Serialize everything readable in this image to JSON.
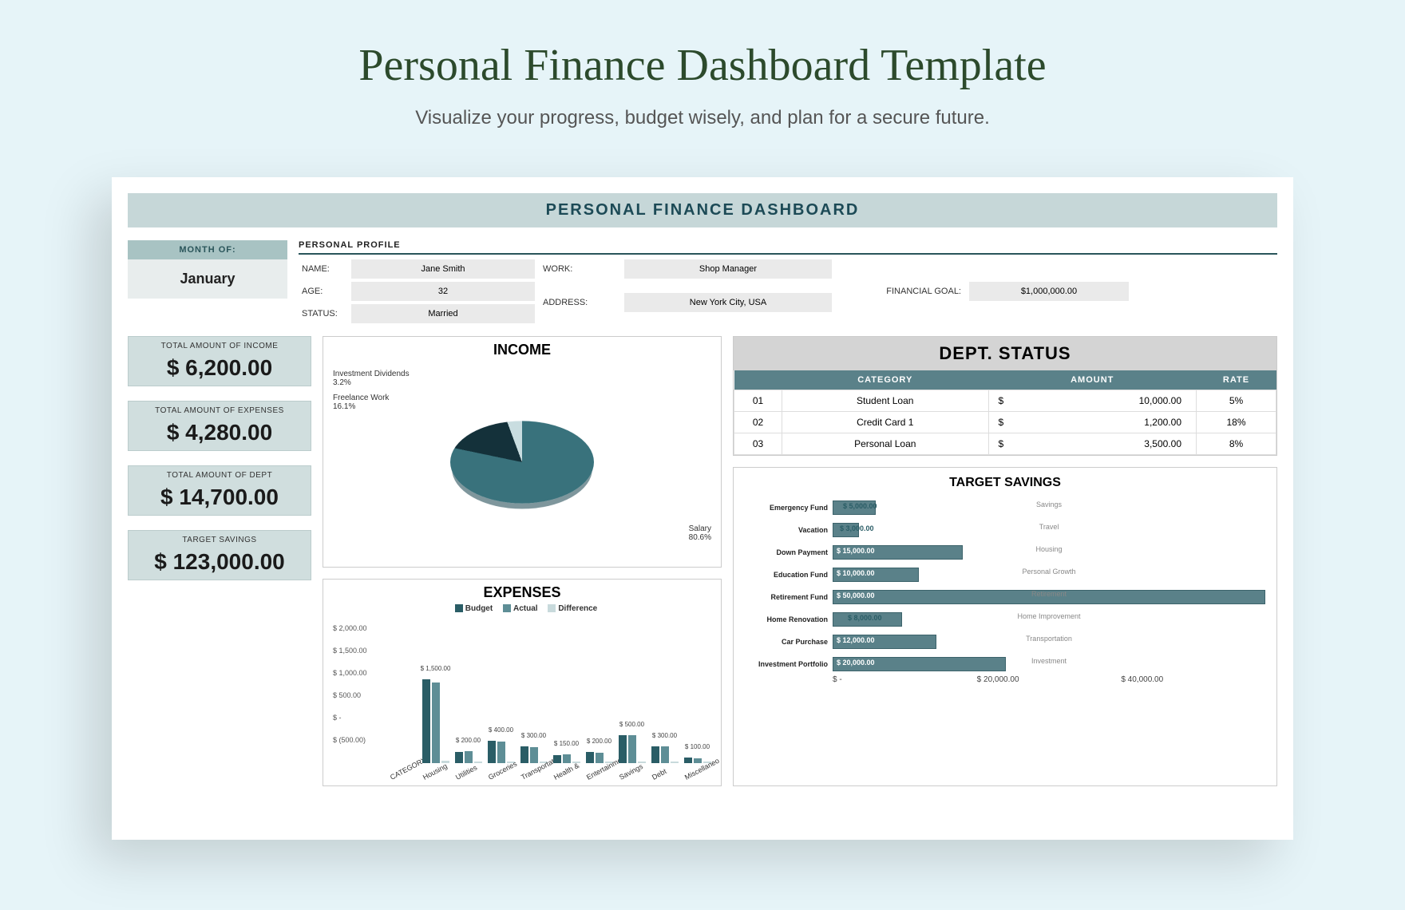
{
  "title": "Personal Finance Dashboard Template",
  "subtitle": "Visualize your progress, budget wisely, and plan for a secure future.",
  "header": "PERSONAL FINANCE DASHBOARD",
  "month": {
    "label": "MONTH OF:",
    "value": "January"
  },
  "profile": {
    "title": "PERSONAL PROFILE",
    "name_label": "NAME:",
    "name": "Jane Smith",
    "age_label": "AGE:",
    "age": "32",
    "status_label": "STATUS:",
    "status": "Married",
    "work_label": "WORK:",
    "work": "Shop Manager",
    "address_label": "ADDRESS:",
    "address": "New York City, USA",
    "goal_label": "FINANCIAL GOAL:",
    "goal": "$1,000,000.00"
  },
  "stats": {
    "income_label": "TOTAL AMOUNT OF INCOME",
    "income": "$  6,200.00",
    "expenses_label": "TOTAL AMOUNT OF EXPENSES",
    "expenses": "$  4,280.00",
    "dept_label": "TOTAL AMOUNT OF DEPT",
    "dept": "$  14,700.00",
    "savings_label": "TARGET SAVINGS",
    "savings": "$ 123,000.00"
  },
  "income_panel": {
    "title": "INCOME",
    "labels": {
      "dividends": "Investment Dividends",
      "dividends_pct": "3.2%",
      "freelance": "Freelance Work",
      "freelance_pct": "16.1%",
      "salary": "Salary",
      "salary_pct": "80.6%"
    }
  },
  "expenses_panel": {
    "title": "EXPENSES",
    "legend": {
      "budget": "Budget",
      "actual": "Actual",
      "diff": "Difference"
    },
    "yaxis": [
      "$ 2,000.00",
      "$ 1,500.00",
      "$ 1,000.00",
      "$ 500.00",
      "$ -",
      "$ (500.00)"
    ]
  },
  "dept_panel": {
    "title": "DEPT. STATUS",
    "headers": {
      "cat": "CATEGORY",
      "amount": "AMOUNT",
      "rate": "RATE"
    },
    "rows": [
      {
        "n": "01",
        "cat": "Student Loan",
        "amt": "10,000.00",
        "rate": "5%"
      },
      {
        "n": "02",
        "cat": "Credit Card 1",
        "amt": "1,200.00",
        "rate": "18%"
      },
      {
        "n": "03",
        "cat": "Personal Loan",
        "amt": "3,500.00",
        "rate": "8%"
      }
    ]
  },
  "savings_panel": {
    "title": "TARGET SAVINGS",
    "axis": [
      "$ -",
      "$ 20,000.00",
      "$ 40,000.00"
    ]
  },
  "chart_data": [
    {
      "type": "pie",
      "title": "INCOME",
      "series": [
        {
          "name": "Salary",
          "value": 80.6
        },
        {
          "name": "Freelance Work",
          "value": 16.1
        },
        {
          "name": "Investment Dividends",
          "value": 3.2
        }
      ]
    },
    {
      "type": "bar",
      "title": "EXPENSES",
      "categories": [
        "CATEGORY",
        "Housing",
        "Utilities",
        "Groceries",
        "Transportati",
        "Health &",
        "Entertainme",
        "Savings",
        "Debt",
        "Miscellaneo"
      ],
      "series": [
        {
          "name": "Budget",
          "values": [
            null,
            1500,
            200,
            400,
            300,
            150,
            200,
            500,
            300,
            100
          ]
        },
        {
          "name": "Actual",
          "values": [
            null,
            1450,
            210,
            380,
            290,
            160,
            180,
            500,
            300,
            90
          ]
        },
        {
          "name": "Difference",
          "values": [
            null,
            50,
            -10,
            20,
            10,
            -10,
            20,
            0,
            0,
            10
          ]
        }
      ],
      "ylim": [
        -500,
        2000
      ],
      "ylabel": "",
      "xlabel": ""
    },
    {
      "type": "bar",
      "title": "TARGET SAVINGS",
      "orientation": "horizontal",
      "categories": [
        "Emergency Fund",
        "Vacation",
        "Down Payment",
        "Education Fund",
        "Retirement Fund",
        "Home Renovation",
        "Car Purchase",
        "Investment Portfolio"
      ],
      "values": [
        5000,
        3000,
        15000,
        10000,
        50000,
        8000,
        12000,
        20000
      ],
      "value_labels": [
        "$ 5,000.00",
        "$ 3,000.00",
        "$ 15,000.00",
        "$ 10,000.00",
        "$ 50,000.00",
        "$ 8,000.00",
        "$ 12,000.00",
        "$ 20,000.00"
      ],
      "secondary_labels": [
        "Savings",
        "Travel",
        "Housing",
        "Personal Growth",
        "Retirement",
        "Home Improvement",
        "Transportation",
        "Investment"
      ],
      "xlim": [
        0,
        50000
      ]
    }
  ]
}
